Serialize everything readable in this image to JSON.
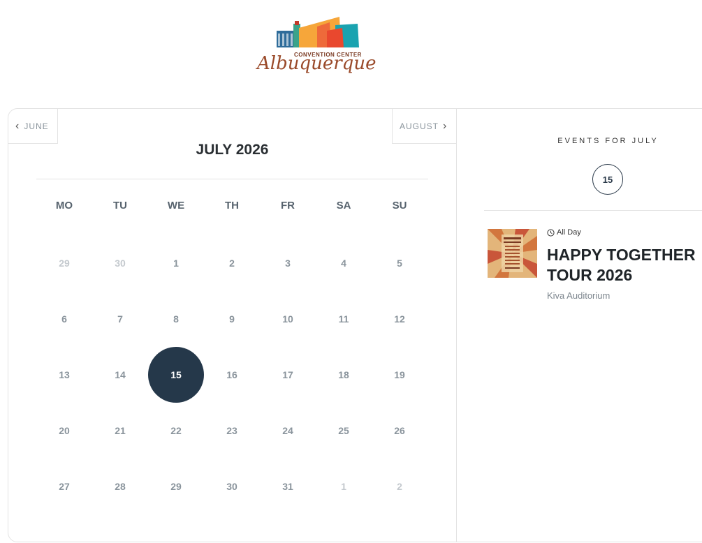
{
  "logo": {
    "subtitle": "CONVENTION CENTER",
    "script": "Albuquerque"
  },
  "nav": {
    "prev": "JUNE",
    "next": "AUGUST"
  },
  "month_title": "JULY 2026",
  "weekdays": [
    "MO",
    "TU",
    "WE",
    "TH",
    "FR",
    "SA",
    "SU"
  ],
  "weeks": [
    [
      "29",
      "30",
      "1",
      "2",
      "3",
      "4",
      "5"
    ],
    [
      "6",
      "7",
      "8",
      "9",
      "10",
      "11",
      "12"
    ],
    [
      "13",
      "14",
      "15",
      "16",
      "17",
      "18",
      "19"
    ],
    [
      "20",
      "21",
      "22",
      "23",
      "24",
      "25",
      "26"
    ],
    [
      "27",
      "28",
      "29",
      "30",
      "31",
      "1",
      "2"
    ]
  ],
  "selected_day": "15",
  "colors": {
    "selected": "#25384a",
    "muted": "#c4c9ce",
    "day": "#8a949c"
  },
  "events_panel": {
    "heading": "EVENTS FOR JULY",
    "badge": "15",
    "event": {
      "time": "All Day",
      "title": "HAPPY TOGETHER TOUR 2026",
      "venue": "Kiva Auditorium",
      "icon": "clock-icon"
    }
  }
}
